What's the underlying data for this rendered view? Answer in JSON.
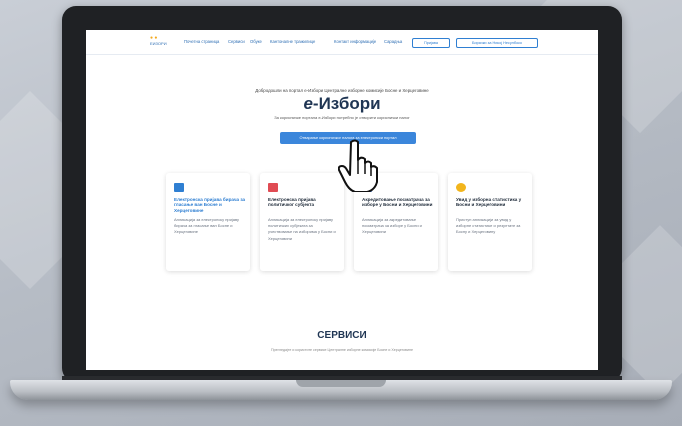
{
  "header": {
    "logo_text": "ЕИЗОРИ",
    "nav": [
      "Почетна страница",
      "Сервиси",
      "Обуке",
      "Кантоналне тражилице",
      "Контакт информације",
      "Сарадња"
    ],
    "buttons": [
      "Пријава",
      "Бирачки за Никој Несулбоко"
    ]
  },
  "welcome_text": "Добродошли на портал е-Избори Централне изборне комисије Босне и Херцеговине",
  "brand": {
    "prefix": "е",
    "dash": "-",
    "name": "Избори"
  },
  "subtitle": "За корисничке портала е-Избори потребно је отворити кориснички налог",
  "main_button": "Отварање корисничког налога за електронски портал",
  "cards": [
    {
      "title": "Електронска пријава бирача за гласање ван Босне и Херцеговине",
      "desc": "Апликација за електронску пријаву бирача за гласање ван Босне и Херцеговине",
      "icon": "ballot-box-icon",
      "color": "#2f7fd2",
      "title_color": "#2f7fd2"
    },
    {
      "title": "Електронска пријава политичког субјекта",
      "desc": "Апликација за електронску пријаву политичких субјеката за учествовање на изборима у Босни и Херцеговини",
      "icon": "flag-icon",
      "color": "#e04b53",
      "title_color": "#1f2b3a"
    },
    {
      "title": "Акредитовање посматрача за изборе у Босни и Херцеговини",
      "desc": "Апликација за акредитовање посматрача за изборе у Босни и Херцеговини",
      "icon": "folder-icon",
      "color": "#3a6fc2",
      "title_color": "#1f2b3a"
    },
    {
      "title": "Увид у изборна статистика у Босни и Херцеговини",
      "desc": "Приступ апликацији за увид у изборне статистике и резултате за Босну и Херцеговину",
      "icon": "person-icon",
      "color": "#f2b51c",
      "title_color": "#1f2b3a"
    }
  ],
  "services_heading": "СЕРВИСИ",
  "services_sub": "Прегледајте и користите сервисе Централне изборне комисије Босне и Херцеговине"
}
